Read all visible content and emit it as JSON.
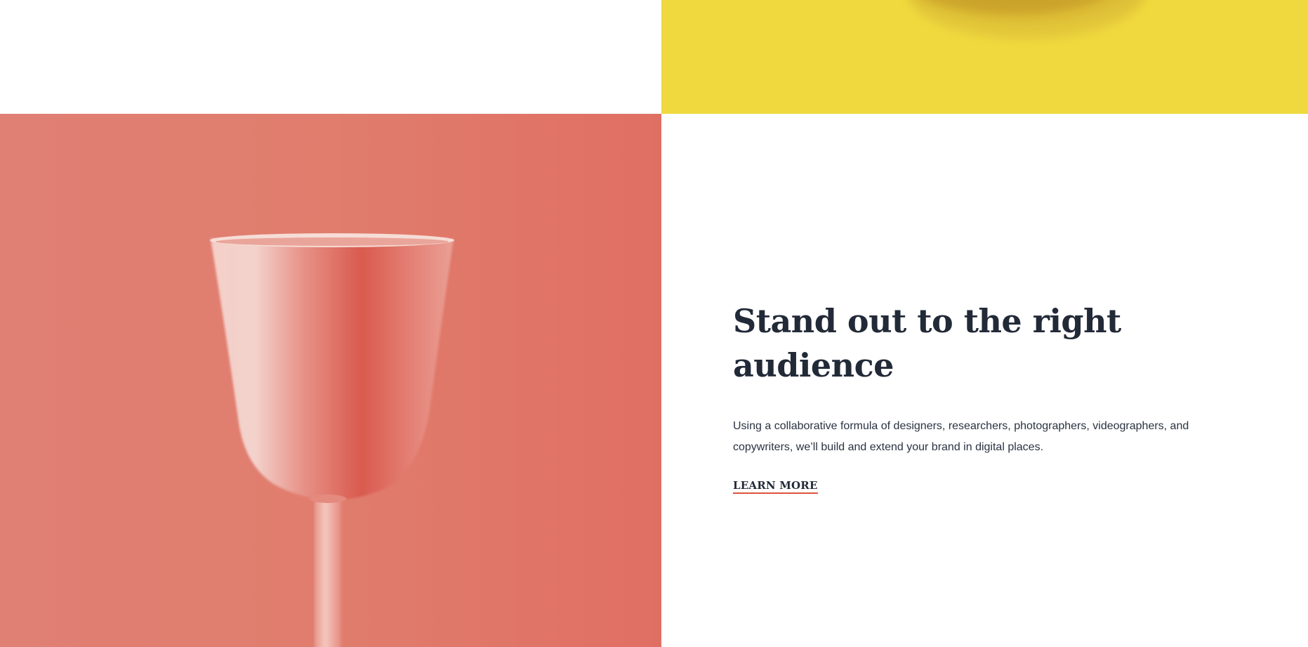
{
  "images": {
    "top_right": {
      "subject": "yellow-background-object",
      "background_color": "#efd93e"
    },
    "bottom_left": {
      "subject": "pink-wine-glass",
      "background_color": "#e07d6d"
    }
  },
  "feature": {
    "headline": "Stand out to the right audience",
    "body": "Using a collaborative formula of designers, researchers, photographers, videographers, and copywriters, we’ll build and extend your brand in digital places.",
    "cta_label": "LEARN MORE"
  },
  "colors": {
    "heading": "#222a38",
    "body": "#2a3342",
    "cta_underline": "#e0523d",
    "yellow": "#efd93e",
    "coral": "#e07d6d"
  }
}
